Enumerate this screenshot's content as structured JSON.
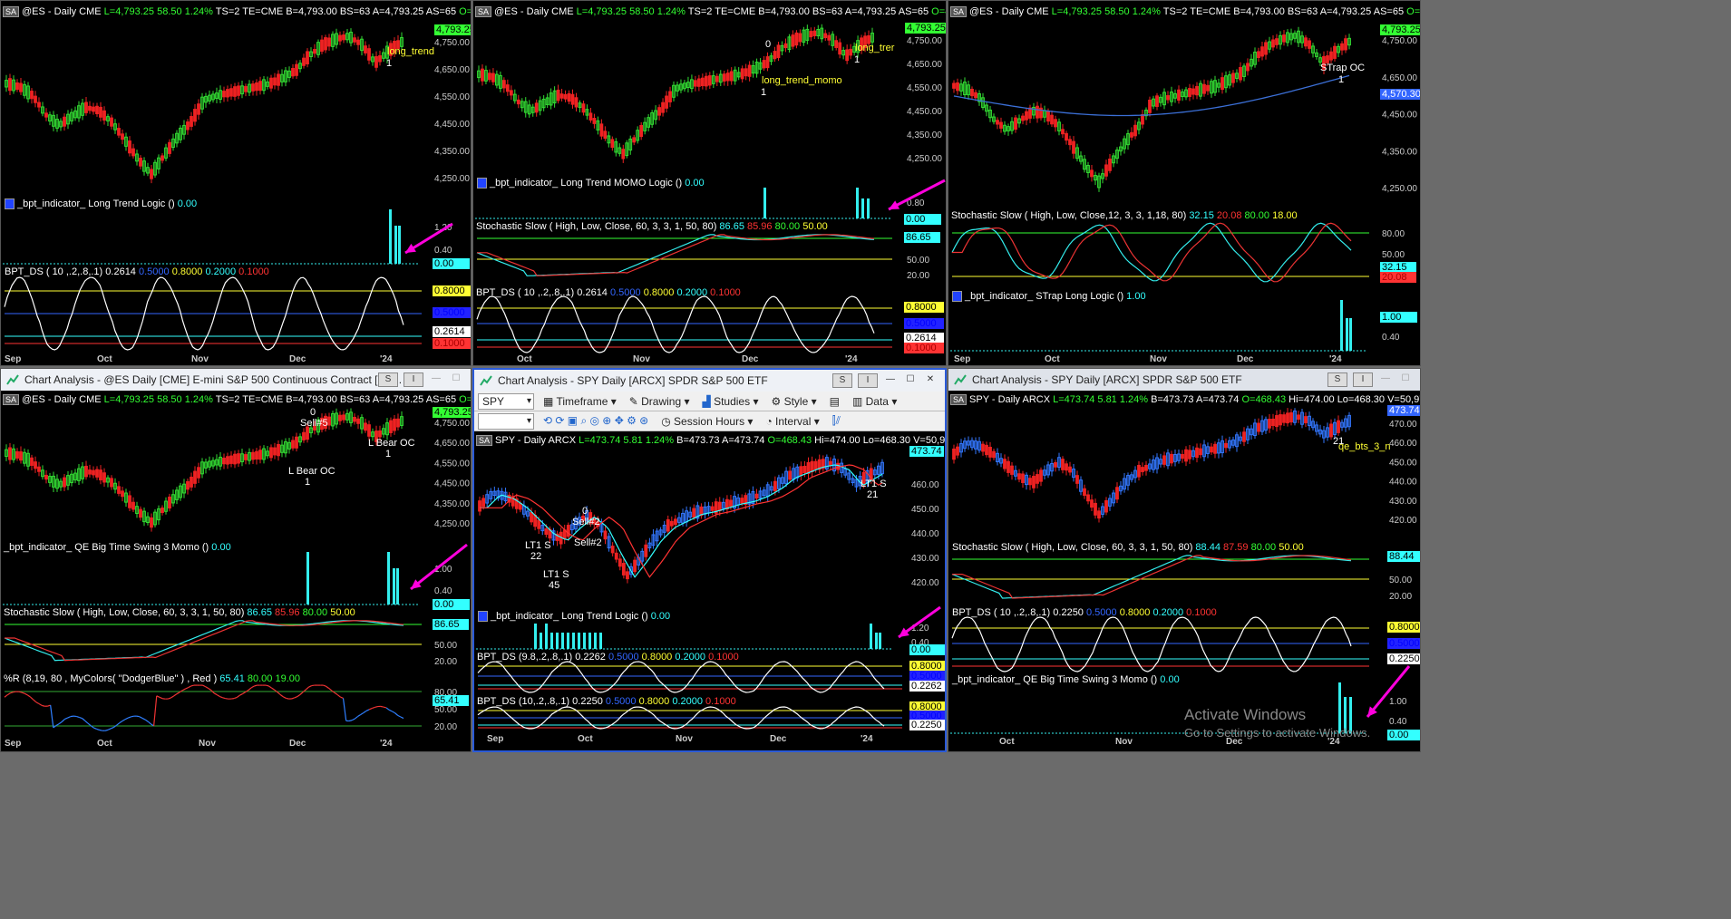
{
  "colors": {
    "up": "#33dd33",
    "down": "#ee2222",
    "blue_up": "#3377ff",
    "cyan": "#33eeee",
    "yellow": "#eeee33",
    "magenta": "#ff00dd",
    "white": "#ffffff"
  },
  "es_header": {
    "sym": "@ES - Daily",
    "ex": "CME",
    "last": "L=4,793.25",
    "chg": "58.50",
    "pct": "1.24%",
    "ts": "TS=2",
    "te": "TE=CME",
    "bid": "B=4,793.00",
    "bs": "BS=63",
    "ask": "A=4,793.25",
    "as": "AS=65",
    "open": "O=4,..."
  },
  "spy_header": {
    "sym": "SPY - Daily",
    "ex": "ARCX",
    "last": "L=473.74",
    "chg": "5.81",
    "pct": "1.24%",
    "bid": "B=473.73",
    "ask": "A=473.74",
    "open": "O=468.43",
    "hi": "Hi=474.00",
    "lo": "Lo=468.30",
    "vol": "V=50,976,817..."
  },
  "sa": "SA",
  "p1": {
    "price_ticks": [
      "4,750.00",
      "4,650.00",
      "4,550.00",
      "4,450.00",
      "4,350.00",
      "4,250.00"
    ],
    "last_tag": "4,793.25",
    "sig_label": "long_trend",
    "sig_num": "1",
    "ind_title": "_bpt_indicator_ Long Trend Logic ()",
    "ind_val": "0.00",
    "ind_ticks": [
      "1.20",
      "0.40"
    ],
    "ind_tag": "0.00",
    "ds_title": "BPT_DS ( 10 ,.2,.8,.1)",
    "ds_vals": [
      "0.2614",
      "0.5000",
      "0.8000",
      "0.2000",
      "0.1000"
    ],
    "ds_tags": [
      "0.8000",
      "0.5000",
      "0.2614",
      "0.1000"
    ],
    "months": [
      "Sep",
      "Oct",
      "Nov",
      "Dec",
      "'24"
    ]
  },
  "p2": {
    "price_ticks": [
      "4,750.00",
      "4,650.00",
      "4,550.00",
      "4,450.00",
      "4,350.00",
      "4,250.00"
    ],
    "last_tag": "4,793.25",
    "sig_zero": "0",
    "sig_label": "long_trend_momo",
    "sig_num": "1",
    "sig_label2": "long_trer",
    "sig_num2": "1",
    "ind_title": "_bpt_indicator_ Long Trend MOMO Logic ()",
    "ind_val": "0.00",
    "ind_ticks": [
      "0.80"
    ],
    "ind_tag": "0.00",
    "st_title": "Stochastic Slow ( High, Low, Close, 60, 3, 3, 1, 50, 80)",
    "st_vals": [
      "86.65",
      "85.96",
      "80.00",
      "50.00"
    ],
    "st_ticks": [
      "50.00",
      "20.00"
    ],
    "st_tag": "86.65",
    "ds_title": "BPT_DS ( 10 ,.2,.8,.1)",
    "ds_vals": [
      "0.2614",
      "0.5000",
      "0.8000",
      "0.2000",
      "0.1000"
    ],
    "ds_tags": [
      "0.8000",
      "0.5000",
      "0.2614",
      "0.1000"
    ],
    "months": [
      "Oct",
      "Nov",
      "Dec",
      "'24"
    ]
  },
  "p3": {
    "price_ticks": [
      "4,750.00",
      "4,650.00",
      "4,450.00",
      "4,350.00",
      "4,250.00"
    ],
    "last_tag": "4,793.25",
    "ma_tag": "4,570.30",
    "sig_label": "STrap OC",
    "sig_num": "1",
    "st_title": "Stochastic Slow ( High, Low, Close,12, 3, 3, 1,18, 80)",
    "st_vals": [
      "32.15",
      "20.08",
      "80.00",
      "18.00"
    ],
    "st_ticks": [
      "80.00",
      "50.00",
      "20.00"
    ],
    "st_tags": [
      "32.15",
      "20.08"
    ],
    "ind_title": "_bpt_indicator_ STrap Long Logic ()",
    "ind_val": "1.00",
    "ind_ticks": [
      "0.40"
    ],
    "ind_tag": "1.00",
    "months": [
      "Sep",
      "Oct",
      "Nov",
      "Dec",
      "'24"
    ]
  },
  "p4": {
    "title": "Chart Analysis - @ES Daily [CME] E-mini S&P 500 Continuous Contract [Ma...",
    "price_ticks": [
      "4,750.00",
      "4,650.00",
      "4,550.00",
      "4,450.00",
      "4,350.00",
      "4,250.00"
    ],
    "last_tag": "4,793.25",
    "sig_zero": "0",
    "sig_sell": "Sell#5",
    "sig_lbear": "L Bear OC",
    "sig_num": "1",
    "sig_lbear2": "L Bear OC",
    "sig_num2": "1",
    "ind_title": "_bpt_indicator_ QE Big Time Swing 3 Momo ()",
    "ind_val": "0.00",
    "ind_ticks": [
      "1.00",
      "0.40"
    ],
    "ind_tag": "0.00",
    "st_title": "Stochastic Slow ( High, Low, Close, 60, 3, 3, 1, 50, 80)",
    "st_vals": [
      "86.65",
      "85.96",
      "80.00",
      "50.00"
    ],
    "st_ticks": [
      "50.00",
      "20.00"
    ],
    "st_tag": "86.65",
    "wr_title": "%R (8,19, 80 , MyColors( \"DodgerBlue\" ) , Red )",
    "wr_vals": [
      "65.41",
      "80.00",
      "19.00"
    ],
    "wr_ticks": [
      "80.00",
      "50.00",
      "20.00"
    ],
    "wr_tag": "65.41",
    "months": [
      "Sep",
      "Oct",
      "Nov",
      "Dec",
      "'24"
    ]
  },
  "p5": {
    "title": "Chart Analysis - SPY Daily [ARCX] SPDR S&P 500 ETF",
    "symbol": "SPY",
    "tb1": [
      "Timeframe",
      "Drawing",
      "Studies",
      "Style",
      "Data"
    ],
    "tb2": [
      "Session Hours",
      "Interval"
    ],
    "price_ticks": [
      "460.00",
      "450.00",
      "440.00",
      "430.00",
      "420.00"
    ],
    "last_tag": "473.74",
    "sig_lt1": "LT1 S",
    "sig_22": "22",
    "sig_45": "45",
    "sig_0": "0",
    "sig_sell": "Sell#2",
    "sig_sell2": "Sell#2",
    "sig_lt1b": "LT1 S",
    "sig_21": "21",
    "ind_title": "_bpt_indicator_ Long Trend Logic ()",
    "ind_val": "0.00",
    "ind_ticks": [
      "1.20",
      "0.40"
    ],
    "ind_tag": "0.00",
    "ds1_title": "BPT_DS (9.8,.2,.8,.1)",
    "ds1_vals": [
      "0.2262",
      "0.5000",
      "0.8000",
      "0.2000",
      "0.1000"
    ],
    "ds1_tags": [
      "0.8000",
      "0.5000",
      "0.2262"
    ],
    "ds2_title": "BPT_DS (10,.2,.8,.1)",
    "ds2_vals": [
      "0.2250",
      "0.5000",
      "0.8000",
      "0.2000",
      "0.1000"
    ],
    "ds2_tags": [
      "0.8000",
      "0.5000",
      "0.2250"
    ],
    "months": [
      "Sep",
      "Oct",
      "Nov",
      "Dec",
      "'24"
    ]
  },
  "p6": {
    "title": "Chart Analysis - SPY Daily [ARCX] SPDR S&P 500 ETF",
    "price_ticks": [
      "470.00",
      "460.00",
      "450.00",
      "440.00",
      "430.00",
      "420.00"
    ],
    "last_tag": "473.74",
    "sig_num": "21",
    "sig_label": "qe_bts_3_n",
    "st_title": "Stochastic Slow ( High, Low, Close, 60, 3, 3, 1, 50, 80)",
    "st_vals": [
      "88.44",
      "87.59",
      "80.00",
      "50.00"
    ],
    "st_ticks": [
      "50.00",
      "20.00"
    ],
    "st_tag": "88.44",
    "ds_title": "BPT_DS ( 10 ,.2,.8,.1)",
    "ds_vals": [
      "0.2250",
      "0.5000",
      "0.8000",
      "0.2000",
      "0.1000"
    ],
    "ds_tags": [
      "0.8000",
      "0.5000",
      "0.2250"
    ],
    "ind_title": "_bpt_indicator_ QE Big Time Swing 3 Momo ()",
    "ind_val": "0.00",
    "ind_ticks": [
      "1.00",
      "0.40"
    ],
    "ind_tag": "0.00",
    "months": [
      "Oct",
      "Nov",
      "Dec",
      "'24"
    ]
  },
  "watermark": {
    "line1": "Activate Windows",
    "line2": "Go to Settings to activate Windows."
  },
  "btn_s": "S",
  "btn_i": "I"
}
